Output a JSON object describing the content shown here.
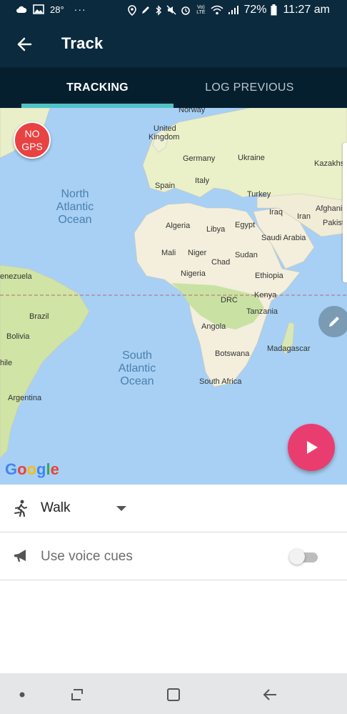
{
  "status_bar": {
    "temperature": "28°",
    "overflow_dots": "···",
    "battery_percent": "72%",
    "time": "11:27 am",
    "network_label": "Vo) LTE"
  },
  "app_bar": {
    "title": "Track",
    "back_icon": "arrow-left-icon"
  },
  "tabs": [
    {
      "label": "TRACKING",
      "active": true
    },
    {
      "label": "LOG PREVIOUS",
      "active": false
    }
  ],
  "map": {
    "gps_badge_line1": "NO",
    "gps_badge_line2": "GPS",
    "attribution": "Google",
    "labels": {
      "norway": "Norway",
      "united_kingdom_1": "United",
      "united_kingdom_2": "Kingdom",
      "germany": "Germany",
      "ukraine": "Ukraine",
      "kazakhstan": "Kazakhs",
      "spain": "Spain",
      "italy": "Italy",
      "turkey": "Turkey",
      "iraq": "Iraq",
      "iran": "Iran",
      "afghanistan": "Afghanis",
      "pakistan": "Pakist",
      "algeria": "Algeria",
      "libya": "Libya",
      "egypt": "Egypt",
      "saudi_arabia": "Saudi Arabia",
      "mali": "Mali",
      "niger": "Niger",
      "chad": "Chad",
      "sudan": "Sudan",
      "nigeria": "Nigeria",
      "ethiopia": "Ethiopia",
      "venezuela": "enezuela",
      "drc": "DRC",
      "kenya": "Kenya",
      "tanzania": "Tanzania",
      "brazil": "Brazil",
      "angola": "Angola",
      "bolivia": "Bolivia",
      "chile": "hile",
      "botswana": "Botswana",
      "madagascar": "Madagascar",
      "south_africa": "South Africa",
      "argentina": "Argentina",
      "north_atlantic_1": "North",
      "north_atlantic_2": "Atlantic",
      "north_atlantic_3": "Ocean",
      "south_atlantic_1": "South",
      "south_atlantic_2": "Atlantic",
      "south_atlantic_3": "Ocean"
    }
  },
  "activity": {
    "icon": "walking-person-icon",
    "value": "Walk"
  },
  "voice_cues": {
    "icon": "megaphone-icon",
    "label": "Use voice cues",
    "enabled": false
  },
  "nav_bar": {
    "items": [
      "dot-icon",
      "recent-apps-icon",
      "home-icon",
      "back-icon"
    ]
  },
  "colors": {
    "header_bg": "#0b2a3e",
    "tab_bg": "#061f2e",
    "tab_indicator": "#4fc3c8",
    "play_button": "#ea3d6f",
    "gps_badge": "#e94242",
    "ocean": "#a7d0f4",
    "land": "#f3efdc"
  }
}
